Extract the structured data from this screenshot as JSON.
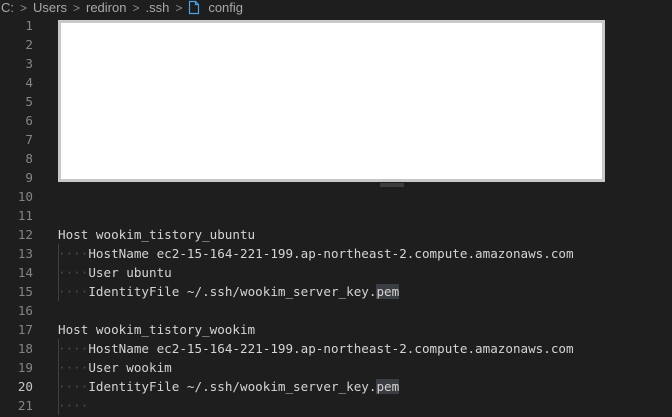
{
  "breadcrumb": {
    "items": [
      "C:",
      "Users",
      "rediron",
      ".ssh",
      "config"
    ],
    "separator": ">",
    "file_icon": "file-icon"
  },
  "editor": {
    "lines": [
      {
        "num": "1",
        "text": ""
      },
      {
        "num": "2",
        "text": ""
      },
      {
        "num": "3",
        "text": ""
      },
      {
        "num": "4",
        "text": ""
      },
      {
        "num": "5",
        "text": ""
      },
      {
        "num": "6",
        "text": ""
      },
      {
        "num": "7",
        "text": ""
      },
      {
        "num": "8",
        "text": ""
      },
      {
        "num": "9",
        "text": ""
      },
      {
        "num": "10",
        "text": ""
      },
      {
        "num": "11",
        "text": ""
      },
      {
        "num": "12",
        "text": "Host wookim_tistory_ubuntu"
      },
      {
        "num": "13",
        "indent": "····",
        "text": "HostName ec2-15-164-221-199.ap-northeast-2.compute.amazonaws.com"
      },
      {
        "num": "14",
        "indent": "····",
        "text": "User ubuntu"
      },
      {
        "num": "15",
        "indent": "····",
        "text": "IdentityFile ~/.ssh/wookim_server_key.",
        "hl": "pem"
      },
      {
        "num": "16",
        "text": ""
      },
      {
        "num": "17",
        "text": "Host wookim_tistory_wookim"
      },
      {
        "num": "18",
        "indent": "····",
        "text": "HostName ec2-15-164-221-199.ap-northeast-2.compute.amazonaws.com"
      },
      {
        "num": "19",
        "indent": "····",
        "text": "User wookim"
      },
      {
        "num": "20",
        "indent": "····",
        "text": "IdentityFile ~/.ssh/wookim_server_key.",
        "hl": "pem",
        "active": true
      },
      {
        "num": "21",
        "indent": "····",
        "text": ""
      }
    ]
  },
  "colors": {
    "background": "#1e1e1e",
    "text": "#d4d4d4",
    "line_number": "#858585",
    "highlight": "#3a3d41",
    "overlay": "#ffffff"
  }
}
